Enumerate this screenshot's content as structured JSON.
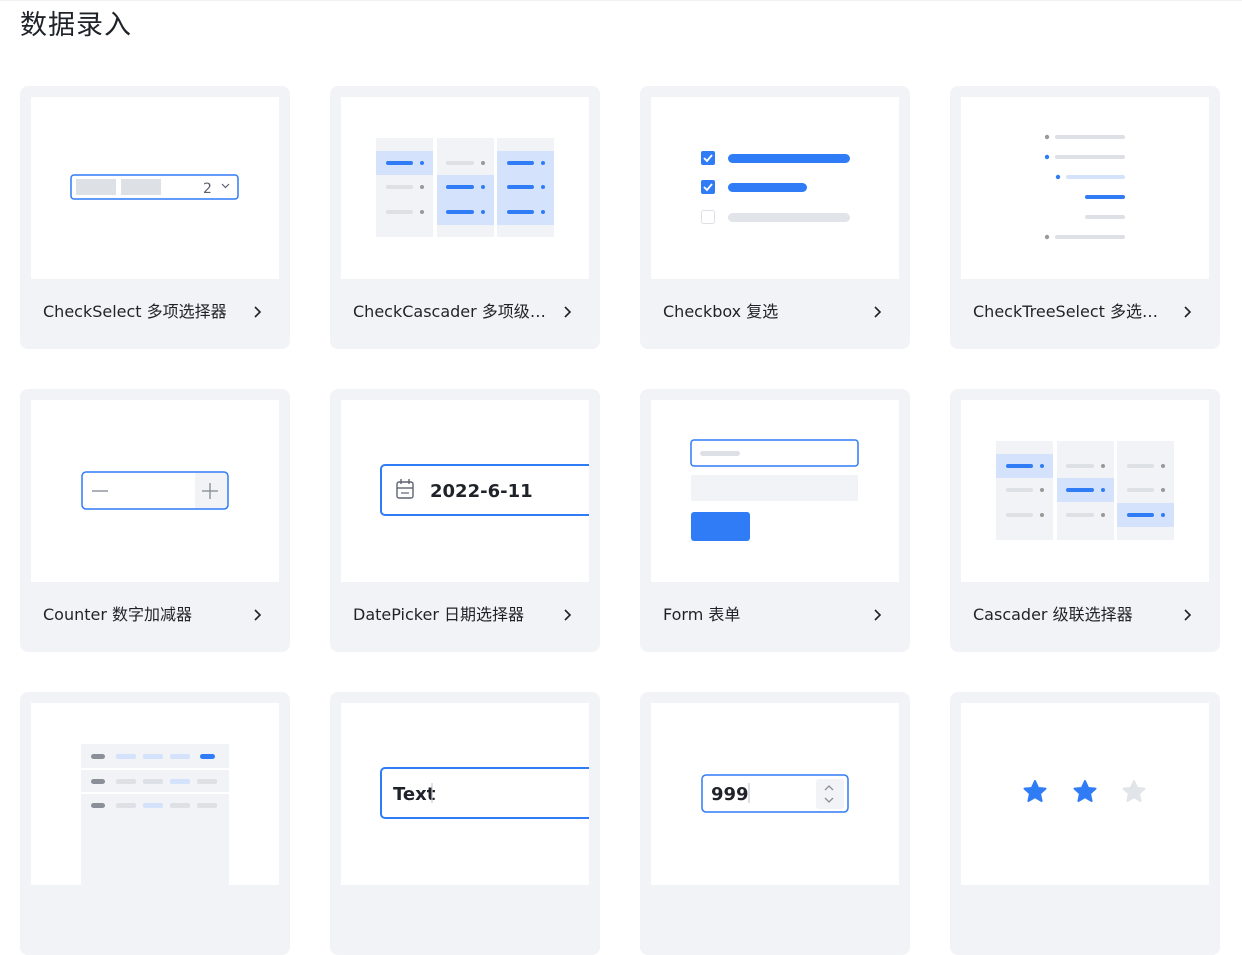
{
  "section": {
    "title": "数据录入"
  },
  "colors": {
    "accent": "#2f7cf6",
    "card_bg": "#f2f3f6",
    "light_gray": "#e1e4e8",
    "light_blue": "#d4e3fb"
  },
  "cards": [
    {
      "label": "CheckSelect 多项选择器",
      "preview_text": "2",
      "icon": "check-select-icon"
    },
    {
      "label": "CheckCascader 多项级联选择器",
      "icon": "check-cascader-icon"
    },
    {
      "label": "Checkbox 复选",
      "icon": "checkbox-icon"
    },
    {
      "label": "CheckTreeSelect 多选树选择器",
      "icon": "tree-select-icon"
    },
    {
      "label": "Counter 数字加减器",
      "icon": "counter-icon"
    },
    {
      "label": "DatePicker 日期选择器",
      "preview_text": "2022-6-11",
      "icon": "calendar-icon"
    },
    {
      "label": "Form 表单",
      "icon": "form-icon"
    },
    {
      "label": "Cascader 级联选择器",
      "icon": "cascader-icon"
    },
    {
      "label": "",
      "icon": "table-icon"
    },
    {
      "label": "",
      "preview_text": "Text",
      "icon": "text-input-icon"
    },
    {
      "label": "",
      "preview_text": "999",
      "icon": "number-input-icon"
    },
    {
      "label": "",
      "icon": "star-icon"
    }
  ]
}
